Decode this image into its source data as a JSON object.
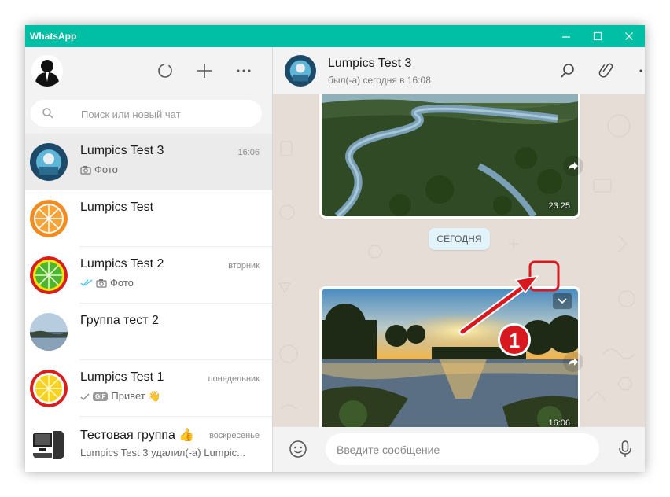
{
  "window": {
    "title": "WhatsApp",
    "controls": [
      "—",
      "☐",
      "✕"
    ]
  },
  "sidebar": {
    "search": {
      "placeholder": "Поиск или новый чат"
    },
    "chats": [
      {
        "name": "Lumpics Test 3",
        "time": "16:06",
        "preview": "Фото",
        "prefix": "camera",
        "active": true
      },
      {
        "name": "Lumpics Test",
        "time": "",
        "preview": "",
        "prefix": ""
      },
      {
        "name": "Lumpics Test 2",
        "time": "вторник",
        "preview": "Фото",
        "prefix": "double-check camera"
      },
      {
        "name": "Группа тест 2",
        "time": "",
        "preview": "",
        "prefix": ""
      },
      {
        "name": "Lumpics Test 1",
        "time": "понедельник",
        "preview": "Привет 👋",
        "prefix": "check GIF"
      },
      {
        "name": "Тестовая группа 👍",
        "time": "воскресенье",
        "preview": "Lumpics Test 3 удалил(-а) Lumpic...",
        "prefix": ""
      }
    ]
  },
  "conversation": {
    "contact_name": "Lumpics Test 3",
    "status": "был(-а) сегодня в 16:08",
    "messages": [
      {
        "type": "image",
        "time": "23:25"
      },
      {
        "type": "image",
        "time": "16:06"
      }
    ],
    "date_separator": "СЕГОДНЯ",
    "compose_placeholder": "Введите сообщение",
    "annotation_number": "1"
  },
  "colors": {
    "accent": "#00bfa5",
    "annotation_red": "#d7191f",
    "chat_bg": "#e6ded6"
  }
}
